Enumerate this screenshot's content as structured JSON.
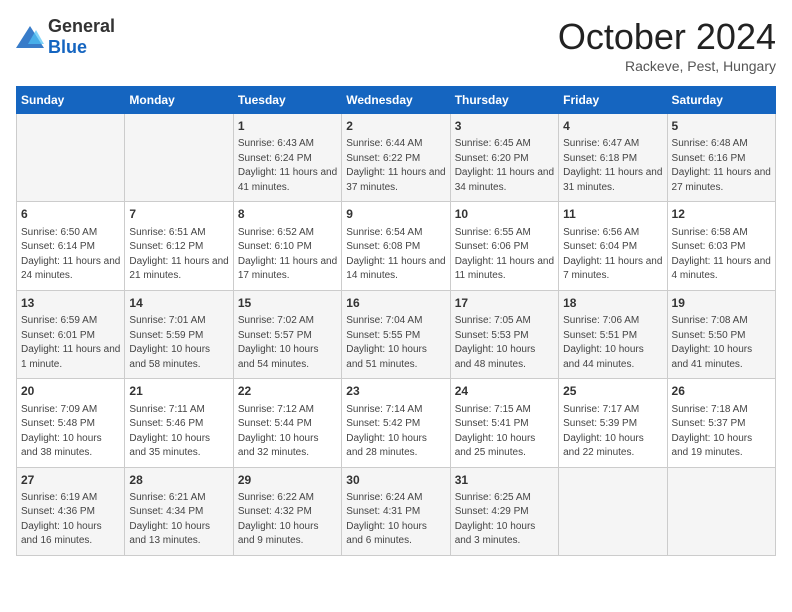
{
  "logo": {
    "general": "General",
    "blue": "Blue"
  },
  "header": {
    "month": "October 2024",
    "location": "Rackeve, Pest, Hungary"
  },
  "days_of_week": [
    "Sunday",
    "Monday",
    "Tuesday",
    "Wednesday",
    "Thursday",
    "Friday",
    "Saturday"
  ],
  "weeks": [
    [
      {
        "day": null
      },
      {
        "day": null
      },
      {
        "day": "1",
        "sunrise": "6:43 AM",
        "sunset": "6:24 PM",
        "daylight": "11 hours and 41 minutes."
      },
      {
        "day": "2",
        "sunrise": "6:44 AM",
        "sunset": "6:22 PM",
        "daylight": "11 hours and 37 minutes."
      },
      {
        "day": "3",
        "sunrise": "6:45 AM",
        "sunset": "6:20 PM",
        "daylight": "11 hours and 34 minutes."
      },
      {
        "day": "4",
        "sunrise": "6:47 AM",
        "sunset": "6:18 PM",
        "daylight": "11 hours and 31 minutes."
      },
      {
        "day": "5",
        "sunrise": "6:48 AM",
        "sunset": "6:16 PM",
        "daylight": "11 hours and 27 minutes."
      }
    ],
    [
      {
        "day": "6",
        "sunrise": "6:50 AM",
        "sunset": "6:14 PM",
        "daylight": "11 hours and 24 minutes."
      },
      {
        "day": "7",
        "sunrise": "6:51 AM",
        "sunset": "6:12 PM",
        "daylight": "11 hours and 21 minutes."
      },
      {
        "day": "8",
        "sunrise": "6:52 AM",
        "sunset": "6:10 PM",
        "daylight": "11 hours and 17 minutes."
      },
      {
        "day": "9",
        "sunrise": "6:54 AM",
        "sunset": "6:08 PM",
        "daylight": "11 hours and 14 minutes."
      },
      {
        "day": "10",
        "sunrise": "6:55 AM",
        "sunset": "6:06 PM",
        "daylight": "11 hours and 11 minutes."
      },
      {
        "day": "11",
        "sunrise": "6:56 AM",
        "sunset": "6:04 PM",
        "daylight": "11 hours and 7 minutes."
      },
      {
        "day": "12",
        "sunrise": "6:58 AM",
        "sunset": "6:03 PM",
        "daylight": "11 hours and 4 minutes."
      }
    ],
    [
      {
        "day": "13",
        "sunrise": "6:59 AM",
        "sunset": "6:01 PM",
        "daylight": "11 hours and 1 minute."
      },
      {
        "day": "14",
        "sunrise": "7:01 AM",
        "sunset": "5:59 PM",
        "daylight": "10 hours and 58 minutes."
      },
      {
        "day": "15",
        "sunrise": "7:02 AM",
        "sunset": "5:57 PM",
        "daylight": "10 hours and 54 minutes."
      },
      {
        "day": "16",
        "sunrise": "7:04 AM",
        "sunset": "5:55 PM",
        "daylight": "10 hours and 51 minutes."
      },
      {
        "day": "17",
        "sunrise": "7:05 AM",
        "sunset": "5:53 PM",
        "daylight": "10 hours and 48 minutes."
      },
      {
        "day": "18",
        "sunrise": "7:06 AM",
        "sunset": "5:51 PM",
        "daylight": "10 hours and 44 minutes."
      },
      {
        "day": "19",
        "sunrise": "7:08 AM",
        "sunset": "5:50 PM",
        "daylight": "10 hours and 41 minutes."
      }
    ],
    [
      {
        "day": "20",
        "sunrise": "7:09 AM",
        "sunset": "5:48 PM",
        "daylight": "10 hours and 38 minutes."
      },
      {
        "day": "21",
        "sunrise": "7:11 AM",
        "sunset": "5:46 PM",
        "daylight": "10 hours and 35 minutes."
      },
      {
        "day": "22",
        "sunrise": "7:12 AM",
        "sunset": "5:44 PM",
        "daylight": "10 hours and 32 minutes."
      },
      {
        "day": "23",
        "sunrise": "7:14 AM",
        "sunset": "5:42 PM",
        "daylight": "10 hours and 28 minutes."
      },
      {
        "day": "24",
        "sunrise": "7:15 AM",
        "sunset": "5:41 PM",
        "daylight": "10 hours and 25 minutes."
      },
      {
        "day": "25",
        "sunrise": "7:17 AM",
        "sunset": "5:39 PM",
        "daylight": "10 hours and 22 minutes."
      },
      {
        "day": "26",
        "sunrise": "7:18 AM",
        "sunset": "5:37 PM",
        "daylight": "10 hours and 19 minutes."
      }
    ],
    [
      {
        "day": "27",
        "sunrise": "6:19 AM",
        "sunset": "4:36 PM",
        "daylight": "10 hours and 16 minutes."
      },
      {
        "day": "28",
        "sunrise": "6:21 AM",
        "sunset": "4:34 PM",
        "daylight": "10 hours and 13 minutes."
      },
      {
        "day": "29",
        "sunrise": "6:22 AM",
        "sunset": "4:32 PM",
        "daylight": "10 hours and 9 minutes."
      },
      {
        "day": "30",
        "sunrise": "6:24 AM",
        "sunset": "4:31 PM",
        "daylight": "10 hours and 6 minutes."
      },
      {
        "day": "31",
        "sunrise": "6:25 AM",
        "sunset": "4:29 PM",
        "daylight": "10 hours and 3 minutes."
      },
      {
        "day": null
      },
      {
        "day": null
      }
    ]
  ]
}
